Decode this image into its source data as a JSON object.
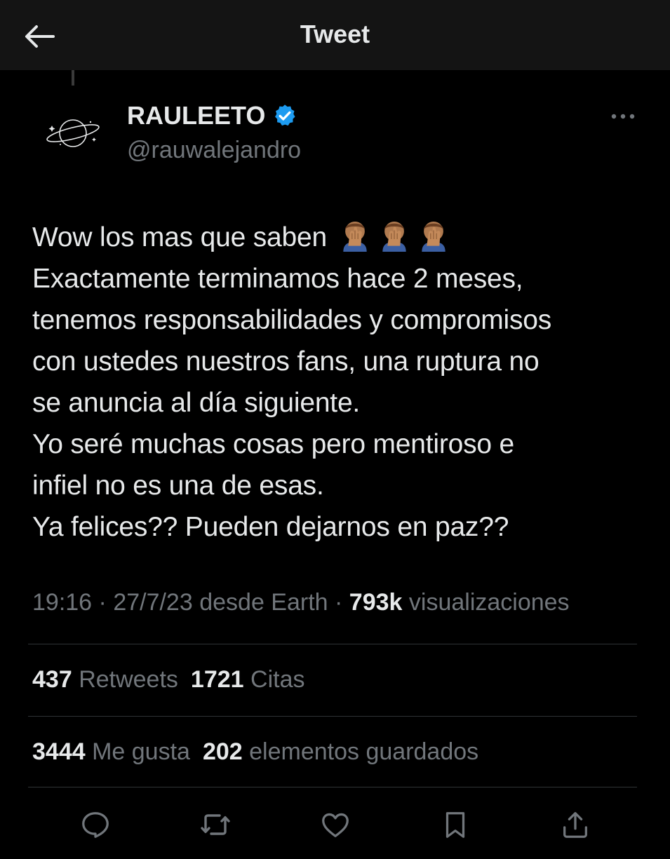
{
  "header": {
    "title": "Tweet"
  },
  "author": {
    "display_name": "RAULEETO",
    "handle": "@rauwalejandro",
    "verified": true,
    "verified_color": "#1d9bf0"
  },
  "tweet": {
    "lines": [
      "Wow los mas que saben",
      "Exactamente terminamos hace 2 meses,",
      "tenemos responsabilidades y compromisos",
      "con ustedes nuestros fans, una ruptura no",
      "se anuncia al día siguiente.",
      "Yo seré muchas cosas pero mentiroso e",
      "infiel no es una de esas.",
      "Ya felices?? Pueden dejarnos en paz??"
    ],
    "first_line_emojis": [
      "face-palm-emoji",
      "face-palm-emoji",
      "face-palm-emoji"
    ]
  },
  "meta": {
    "time": "19:16",
    "separator": " · ",
    "date": "27/7/23",
    "source": "desde Earth",
    "views_count": "793k",
    "views_label": "visualizaciones"
  },
  "stats": {
    "retweets": {
      "count": "437",
      "label": "Retweets"
    },
    "quotes": {
      "count": "1721",
      "label": "Citas"
    },
    "likes": {
      "count": "3444",
      "label": "Me gusta"
    },
    "bookmarks": {
      "count": "202",
      "label": "elementos guardados"
    }
  },
  "actions": [
    "reply-icon",
    "retweet-icon",
    "like-icon",
    "bookmark-icon",
    "share-icon"
  ],
  "colors": {
    "background": "#000000",
    "header_background": "#141414",
    "primary_text": "#e7e9ea",
    "secondary_text": "#71767b",
    "divider": "#2f3336"
  }
}
